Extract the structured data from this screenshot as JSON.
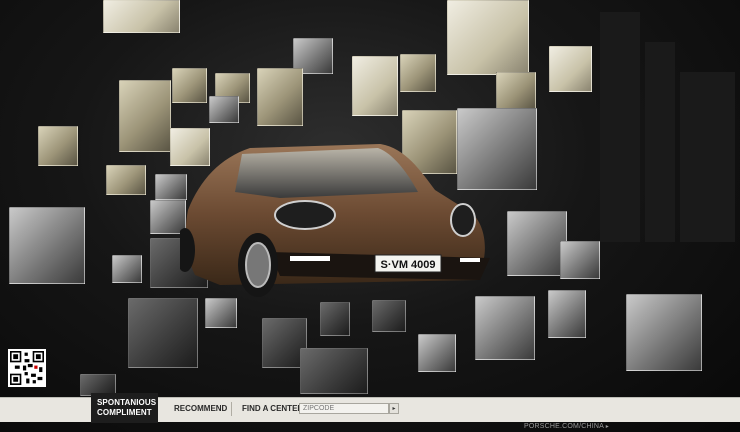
{
  "car": {
    "plate": "S·VM 4009"
  },
  "toolbar": {
    "compliment_line1": "SPONTANIOUS",
    "compliment_line2": "COMPLIMENT",
    "recommend_label": "RECOMMEND",
    "find_center_label": "FIND A CENTER:",
    "zipcode_placeholder": "ZIPCODE",
    "submit_icon": "arrow-right-icon"
  },
  "footer": {
    "link_label": "PORSCHE.COM/CHINA"
  },
  "colors": {
    "background": "#0d0d0d",
    "bar": "#e8e6e0",
    "car_body": "#6b4a32"
  }
}
